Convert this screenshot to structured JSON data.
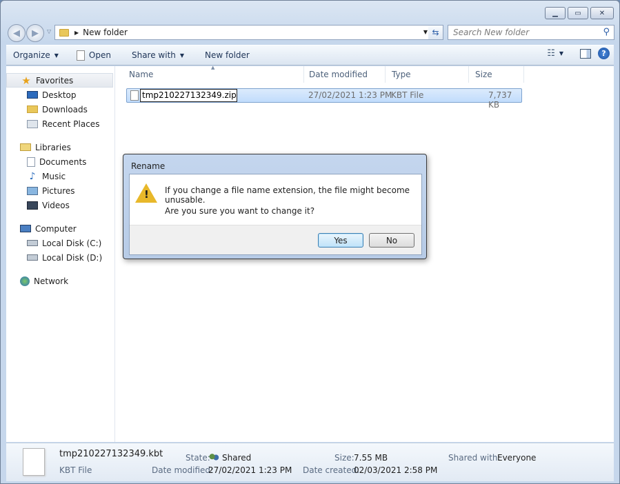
{
  "window": {
    "controls": [
      "▁",
      "▭",
      "✕"
    ]
  },
  "address_bar": {
    "path": "New folder"
  },
  "search": {
    "placeholder": "Search New folder"
  },
  "toolbar": {
    "organize": "Organize",
    "open": "Open",
    "share_with": "Share with",
    "new_folder": "New folder"
  },
  "nav": {
    "favorites": {
      "label": "Favorites",
      "items": [
        "Desktop",
        "Downloads",
        "Recent Places"
      ]
    },
    "libraries": {
      "label": "Libraries",
      "items": [
        "Documents",
        "Music",
        "Pictures",
        "Videos"
      ]
    },
    "computer": {
      "label": "Computer",
      "items": [
        "Local Disk (C:)",
        "Local Disk (D:)"
      ]
    },
    "network": {
      "label": "Network"
    }
  },
  "columns": [
    "Name",
    "Date modified",
    "Type",
    "Size"
  ],
  "files": [
    {
      "name_editing": "tmp210227132349.zip",
      "date_modified": "27/02/2021 1:23 PM",
      "type": "KBT File",
      "size": "7,737 KB"
    }
  ],
  "details": {
    "file_name": "tmp210227132349.kbt",
    "file_type": "KBT File",
    "state_label": "State:",
    "state_value": "Shared",
    "date_modified_label": "Date modified:",
    "date_modified_value": "27/02/2021 1:23 PM",
    "size_label": "Size:",
    "size_value": "7.55 MB",
    "date_created_label": "Date created:",
    "date_created_value": "02/03/2021 2:58 PM",
    "shared_with_label": "Shared with:",
    "shared_with_value": "Everyone"
  },
  "dialog": {
    "title": "Rename",
    "message_line1": "If you change a file name extension, the file might become unusable.",
    "message_line2": "Are you sure you want to change it?",
    "yes_label": "Yes",
    "no_label": "No"
  }
}
